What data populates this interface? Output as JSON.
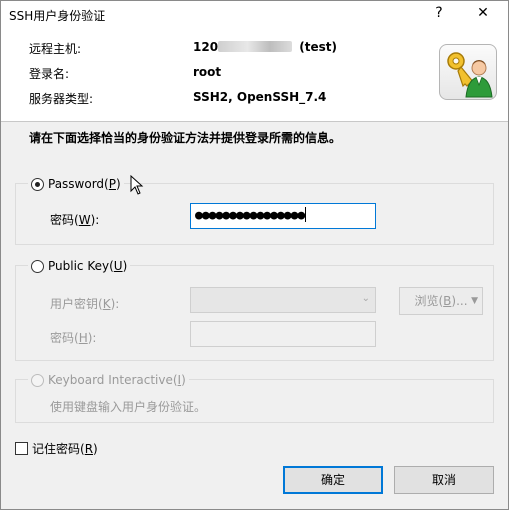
{
  "window": {
    "title": "SSH用户身份验证",
    "help_glyph": "?",
    "close_glyph": "✕"
  },
  "info": {
    "host_label": "远程主机:",
    "host_value_prefix": "120",
    "host_value_suffix": " (test)",
    "login_label": "登录名:",
    "login_value": "root",
    "server_type_label": "服务器类型:",
    "server_type_value": "SSH2, OpenSSH_7.4",
    "app_icon": "key-user-icon"
  },
  "instruction": "请在下面选择恰当的身份验证方法并提供登录所需的信息。",
  "password_group": {
    "label": "Password(",
    "mnemonic": "P",
    "label_end": ")",
    "selected": true,
    "field_label": "密码(",
    "field_mnemonic": "W",
    "field_label_end": "):",
    "field_value": "●●●●●●●●●●●●●●●●"
  },
  "public_key_group": {
    "label": "Public Key(",
    "mnemonic": "U",
    "label_end": ")",
    "user_key_label": "用户密钥(",
    "user_key_mnemonic": "K",
    "user_key_label_end": "):",
    "browse_label": "浏览(",
    "browse_mnemonic": "B",
    "browse_label_end": ")...",
    "passphrase_label": "密码(",
    "passphrase_mnemonic": "H",
    "passphrase_label_end": "):"
  },
  "keyboard_group": {
    "label": "Keyboard Interactive(",
    "mnemonic": "I",
    "label_end": ")",
    "note": "使用键盘输入用户身份验证。"
  },
  "remember": {
    "label": "记住密码(",
    "mnemonic": "R",
    "label_end": ")",
    "checked": false
  },
  "buttons": {
    "ok": "确定",
    "cancel": "取消"
  },
  "colors": {
    "accent": "#0078d7",
    "panel_bg": "#f0f0f0",
    "disabled_text": "#9a9a9a"
  }
}
